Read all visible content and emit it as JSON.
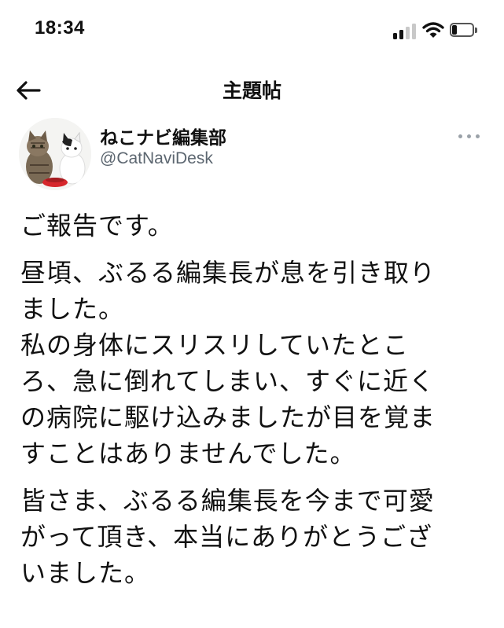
{
  "status_bar": {
    "time": "18:34",
    "battery_level": 0.25
  },
  "header": {
    "back_icon": "arrow-left-icon",
    "title": "主題帖"
  },
  "author": {
    "display_name": "ねこナビ編集部",
    "handle": "@CatNaviDesk",
    "more_icon": "more-dots-icon"
  },
  "tweet": {
    "paragraphs": [
      {
        "lines": [
          "ご報告です。"
        ]
      },
      {
        "lines": [
          "昼頃、ぶるる編集長が息を引き取り",
          "ました。",
          "私の身体にスリスリしていたとこ",
          "ろ、急に倒れてしまい、すぐに近く",
          "の病院に駆け込みましたが目を覚ま",
          "すことはありませんでした。"
        ]
      },
      {
        "lines": [
          "皆さま、ぶるる編集長を今まで可愛",
          "がって頂き、本当にありがとうござ",
          "いました。"
        ]
      }
    ]
  },
  "colors": {
    "text_primary": "#111111",
    "text_secondary": "#5c6670",
    "background": "#ffffff"
  }
}
